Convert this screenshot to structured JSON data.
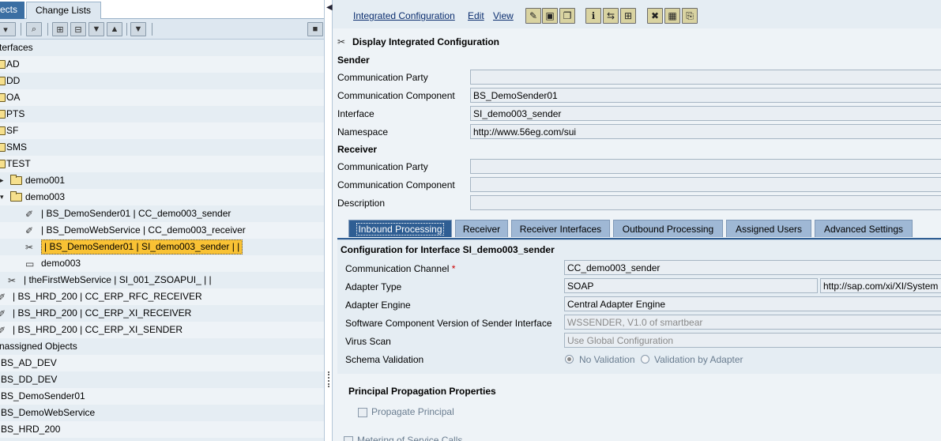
{
  "left": {
    "tabs": [
      "ects",
      "Change Lists"
    ],
    "tree": [
      {
        "label": "terfaces",
        "type": "section"
      },
      {
        "label": "AD",
        "type": "folder"
      },
      {
        "label": "DD",
        "type": "folder"
      },
      {
        "label": "OA",
        "type": "folder"
      },
      {
        "label": "PTS",
        "type": "folder"
      },
      {
        "label": "SF",
        "type": "folder"
      },
      {
        "label": "SMS",
        "type": "folder"
      },
      {
        "label": "TEST",
        "type": "folder-open"
      },
      {
        "label": "demo001",
        "type": "folder"
      },
      {
        "label": "demo003",
        "type": "folder-open"
      },
      {
        "label": "| BS_DemoSender01 | CC_demo003_sender",
        "type": "channel"
      },
      {
        "label": "| BS_DemoWebService | CC_demo003_receiver",
        "type": "channel"
      },
      {
        "label": "| BS_DemoSender01 | SI_demo003_sender |  |",
        "type": "config",
        "selected": true
      },
      {
        "label": "demo003",
        "type": "scenario"
      },
      {
        "label": "| theFirstWebService | SI_001_ZSOAPUI_ |  |",
        "type": "config"
      },
      {
        "label": "| BS_HRD_200 | CC_ERP_RFC_RECEIVER",
        "type": "channel"
      },
      {
        "label": "| BS_HRD_200 | CC_ERP_XI_RECEIVER",
        "type": "channel"
      },
      {
        "label": "| BS_HRD_200 | CC_ERP_XI_SENDER",
        "type": "channel"
      },
      {
        "label": "nassigned Objects",
        "type": "section"
      },
      {
        "label": "BS_AD_DEV",
        "type": "plain"
      },
      {
        "label": "BS_DD_DEV",
        "type": "plain"
      },
      {
        "label": "BS_DemoSender01",
        "type": "plain"
      },
      {
        "label": "BS_DemoWebService",
        "type": "plain"
      },
      {
        "label": "BS_HRD_200",
        "type": "plain"
      }
    ]
  },
  "right": {
    "menu": {
      "integrated": "Integrated Configuration",
      "edit": "Edit",
      "view": "View"
    },
    "title": "Display Integrated Configuration",
    "sender": {
      "header": "Sender",
      "party_label": "Communication Party",
      "party_value": "",
      "component_label": "Communication Component",
      "component_value": "BS_DemoSender01",
      "interface_label": "Interface",
      "interface_value": "SI_demo003_sender",
      "namespace_label": "Namespace",
      "namespace_value": "http://www.56eg.com/sui"
    },
    "receiver": {
      "header": "Receiver",
      "party_label": "Communication Party",
      "party_value": "",
      "component_label": "Communication Component",
      "component_value": "",
      "description_label": "Description",
      "description_value": ""
    },
    "tabs": [
      "Inbound Processing",
      "Receiver",
      "Receiver Interfaces",
      "Outbound Processing",
      "Assigned Users",
      "Advanced Settings"
    ],
    "config": {
      "header": "Configuration for Interface SI_demo003_sender",
      "channel_label": "Communication Channel",
      "required_mark": "*",
      "channel_value": "CC_demo003_sender",
      "adapter_type_label": "Adapter Type",
      "adapter_type_value": "SOAP",
      "adapter_ns_value": "http://sap.com/xi/XI/System",
      "engine_label": "Adapter Engine",
      "engine_value": "Central Adapter Engine",
      "swcv_label": "Software Component Version of Sender Interface",
      "swcv_value": "WSSENDER, V1.0 of smartbear",
      "virus_label": "Virus Scan",
      "virus_value": "Use Global Configuration",
      "schema_label": "Schema Validation",
      "schema_opt1": "No Validation",
      "schema_opt2": "Validation by Adapter"
    },
    "principal": {
      "header": "Principal Propagation Properties",
      "propagate_label": "Propagate Principal",
      "metering_label": "Metering of Service Calls"
    }
  },
  "colors": {
    "selected": "#f9c234",
    "tab_active": "#2f5e93",
    "tab": "#9fb8d5"
  }
}
